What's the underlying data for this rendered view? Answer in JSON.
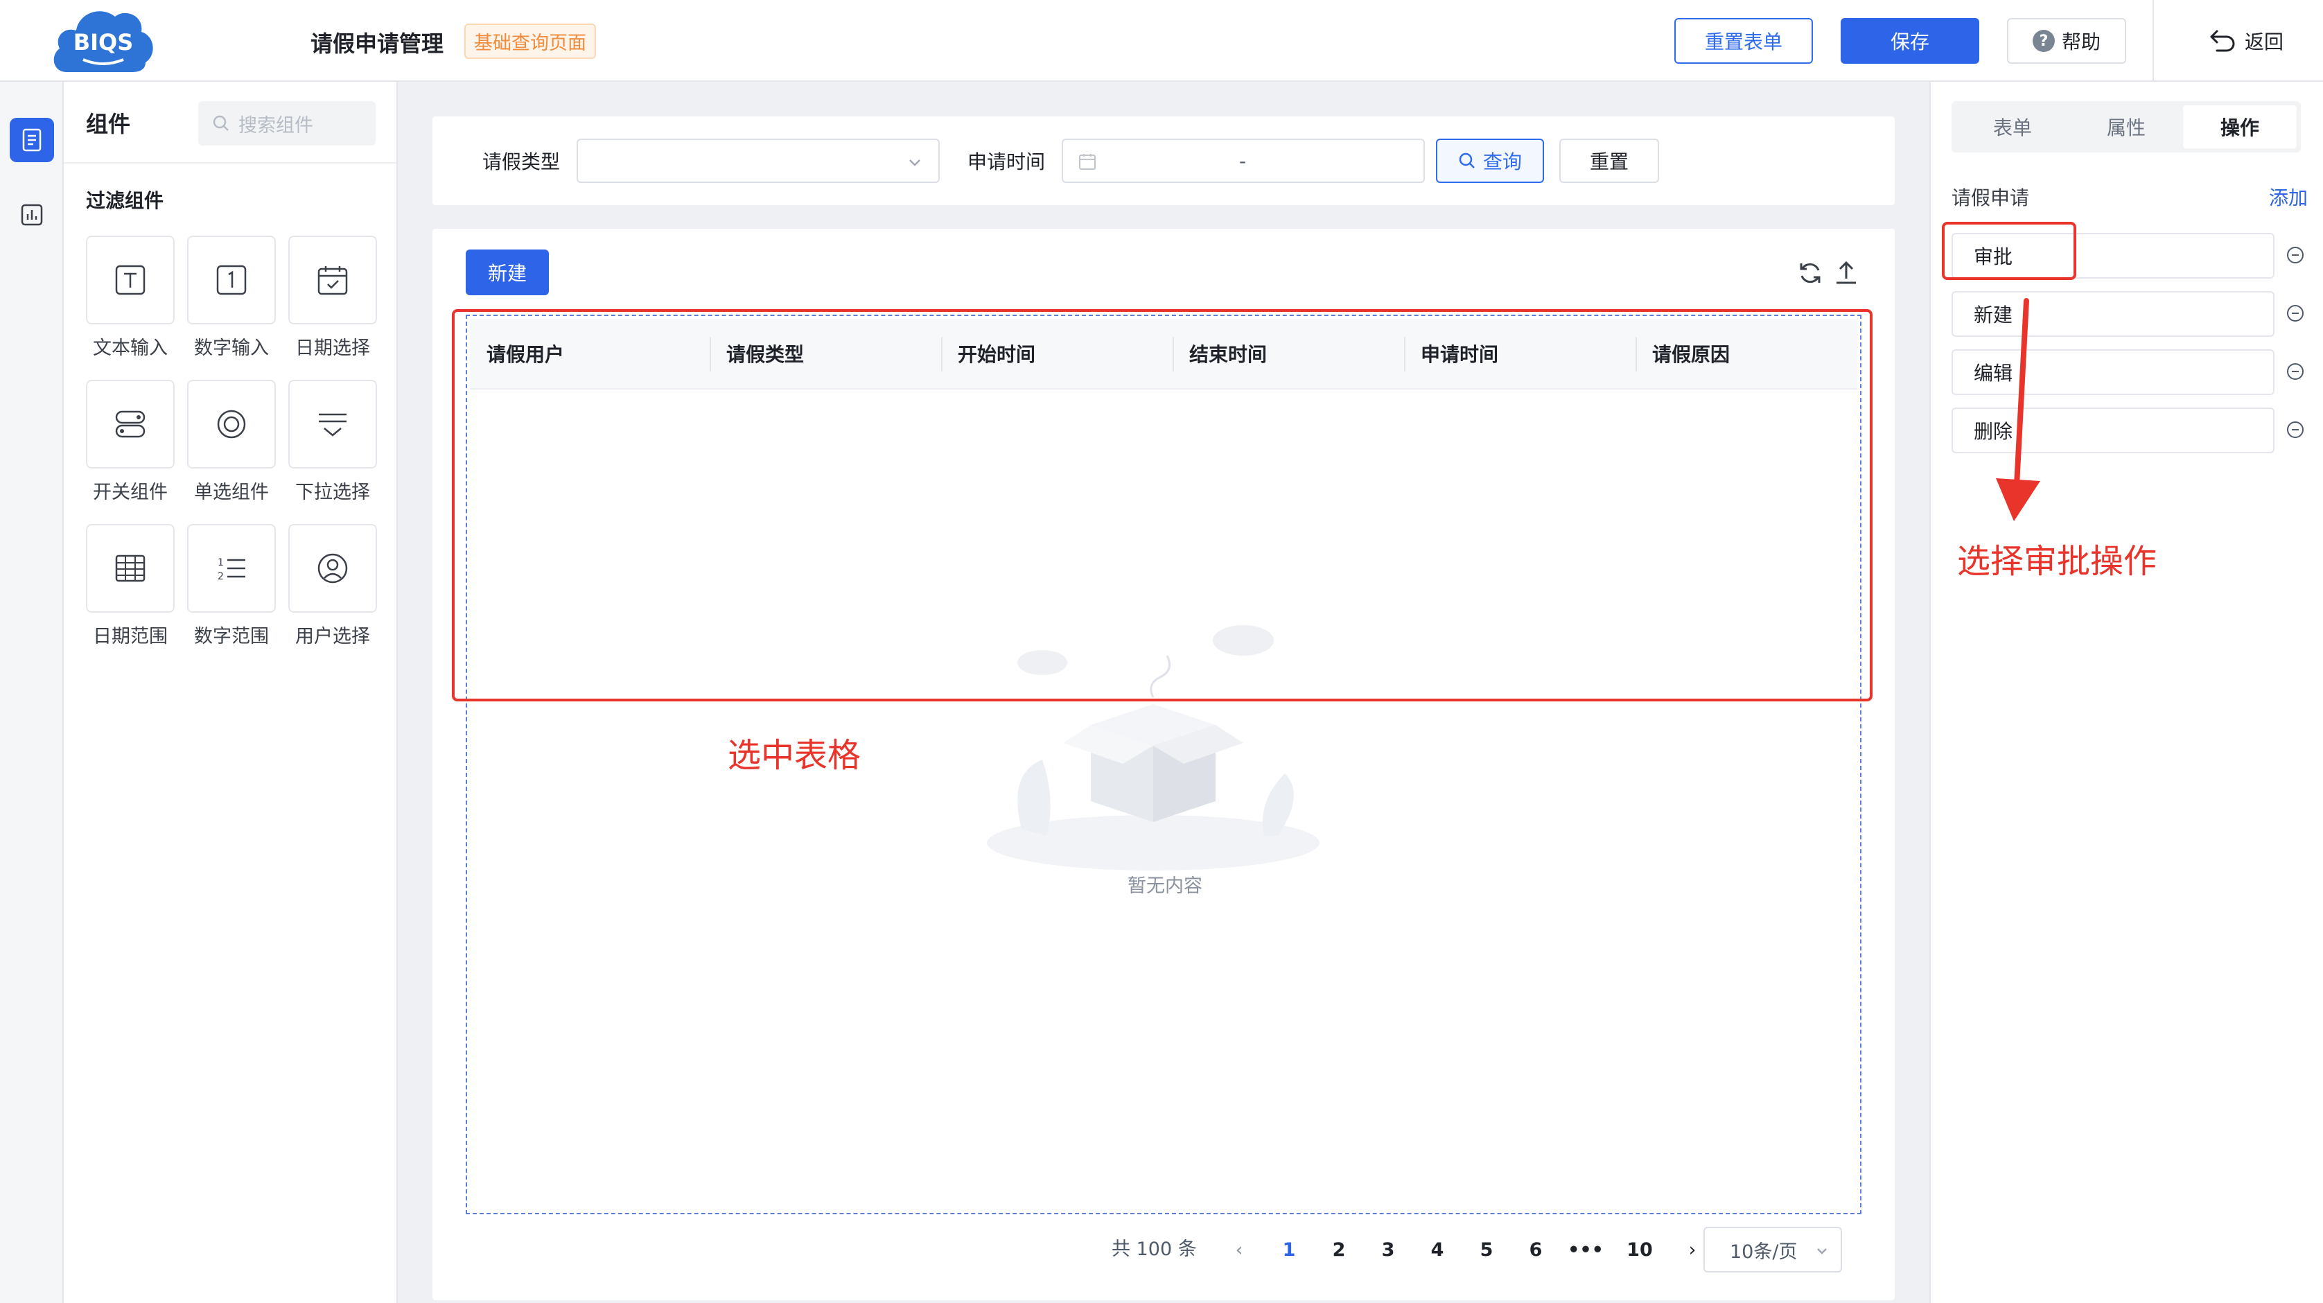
{
  "header": {
    "logo_text": "BIQS",
    "page_title": "请假申请管理",
    "page_tag": "基础查询页面",
    "reset_form_label": "重置表单",
    "save_label": "保存",
    "help_label": "帮助",
    "back_label": "返回"
  },
  "components": {
    "title": "组件",
    "search_placeholder": "搜索组件",
    "filter_title": "过滤组件",
    "items": [
      {
        "label": "文本输入",
        "icon": "text-input-icon"
      },
      {
        "label": "数字输入",
        "icon": "number-input-icon"
      },
      {
        "label": "日期选择",
        "icon": "date-picker-icon"
      },
      {
        "label": "开关组件",
        "icon": "switch-icon"
      },
      {
        "label": "单选组件",
        "icon": "radio-icon"
      },
      {
        "label": "下拉选择",
        "icon": "dropdown-icon"
      },
      {
        "label": "日期范围",
        "icon": "date-range-icon"
      },
      {
        "label": "数字范围",
        "icon": "number-range-icon"
      },
      {
        "label": "用户选择",
        "icon": "user-select-icon"
      }
    ]
  },
  "search_bar": {
    "type_label": "请假类型",
    "type_value": "",
    "time_label": "申请时间",
    "time_separator": "-",
    "query_label": "查询",
    "reset_label": "重置"
  },
  "table": {
    "new_label": "新建",
    "columns": [
      "请假用户",
      "请假类型",
      "开始时间",
      "结束时间",
      "申请时间",
      "请假原因"
    ],
    "rows": [],
    "empty_text": "暂无内容"
  },
  "pagination": {
    "total": "共 100 条",
    "pages": [
      "1",
      "2",
      "3",
      "4",
      "5",
      "6",
      "•••",
      "10"
    ],
    "current": "1",
    "prev": "‹",
    "next": "›",
    "page_size": "10条/页"
  },
  "props_panel": {
    "tabs": [
      "表单",
      "属性",
      "操作"
    ],
    "active_tab": "操作",
    "section_title": "请假申请",
    "add_label": "添加",
    "operations": [
      "审批",
      "新建",
      "编辑",
      "删除"
    ]
  },
  "annotations": {
    "table_note": "选中表格",
    "approve_note": "选择审批操作",
    "color": "#e8342a"
  },
  "colors": {
    "primary": "#2e64e8",
    "tag_orange": "#f08c3c",
    "annotation_red": "#e8342a"
  }
}
